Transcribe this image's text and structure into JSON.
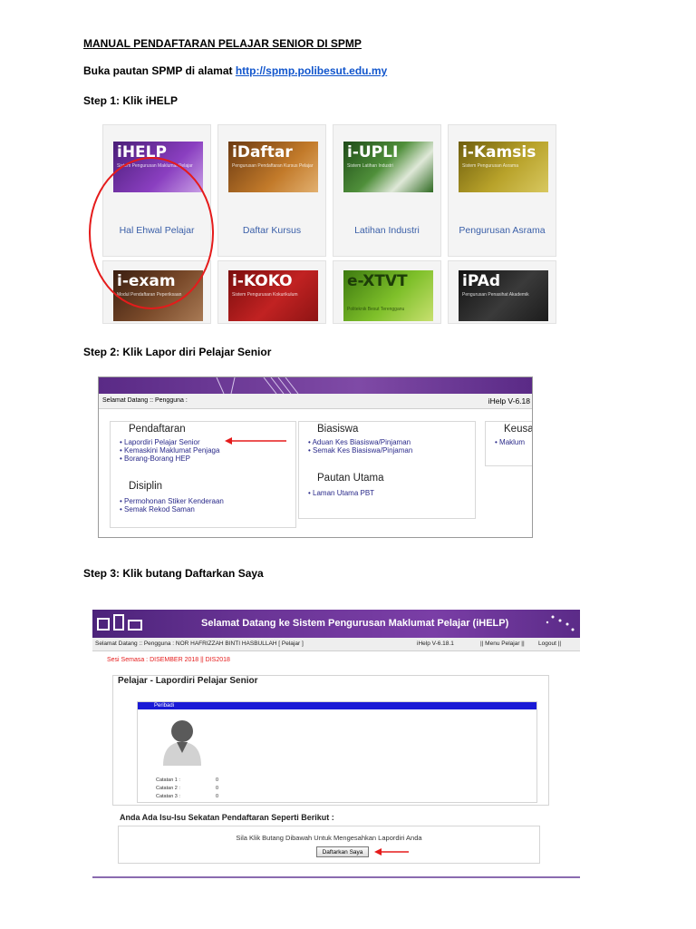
{
  "title": "MANUAL PENDAFTARAN PELAJAR SENIOR DI SPMP",
  "intro": {
    "text": "Buka pautan  SPMP di alamat ",
    "link": "http://spmp.polibesut.edu.my"
  },
  "step1": {
    "heading": "Step 1: Klik iHELP",
    "tiles": [
      {
        "banner": "iHELP",
        "sub": "Sistem Pengurusan Maklumat Pelajar",
        "label": "Hal Ehwal Pelajar",
        "color": "#6b2b9e"
      },
      {
        "banner": "iDaftar",
        "sub": "Pengurusan Pendaftaran Kursus Pelajar",
        "label": "Daftar Kursus",
        "color": "#b5651d"
      },
      {
        "banner": "i-UPLI",
        "sub": "Sistem Latihan Industri",
        "label": "Latihan Industri",
        "color": "#3d7a2d"
      },
      {
        "banner": "i-Kamsis",
        "sub": "Sistem Pengurusan Asrama",
        "label": "Pengurusan Asrama",
        "color": "#9a8a1a"
      },
      {
        "banner": "i-exam",
        "sub": "Modul Pendaftaran Peperiksaan",
        "label": "",
        "color": "#6b3b22"
      },
      {
        "banner": "i-KOKO",
        "sub": "Sistem Pengurusan Kokurikulum",
        "label": "",
        "color": "#a81b1b"
      },
      {
        "banner": "e-XTVT",
        "sub": "Politeknik Besut Terengganu",
        "label": "",
        "color": "#5e9a1e"
      },
      {
        "banner": "iPAd",
        "sub": "Pengurusan Penasihat Akademik",
        "label": "",
        "color": "#2a2a2a"
      }
    ]
  },
  "step2": {
    "heading": "Step 2: Klik Lapor diri Pelajar Senior",
    "welcome": "Selamat Datang :: Pengguna :",
    "version": "iHelp V-6.18",
    "pendaftaran": {
      "title": "Pendaftaran",
      "items": [
        "Lapordiri Pelajar Senior",
        "Kemaskini Maklumat Penjaga",
        "Borang-Borang HEP"
      ]
    },
    "disiplin": {
      "title": "Disiplin",
      "items": [
        "Permohonan Stiker Kenderaan",
        "Semak Rekod Saman"
      ]
    },
    "biasiswa": {
      "title": "Biasiswa",
      "items": [
        "Aduan Kes Biasiswa/Pinjaman",
        "Semak Kes Biasiswa/Pinjaman"
      ]
    },
    "pautan": {
      "title": "Pautan Utama",
      "items": [
        "Laman Utama PBT"
      ]
    },
    "keusahawanan": {
      "title": "Keusa",
      "items": [
        "Maklum"
      ]
    }
  },
  "step3": {
    "heading": "Step 3: Klik butang Daftarkan Saya",
    "header_title": "Selamat Datang ke Sistem Pengurusan Maklumat Pelajar (iHELP)",
    "welcome": "Selamat Datang :: Pengguna : NOR HAFRIZZAH BINTI HASBULLAH [ Pelajar ]",
    "version": "iHelp V-6.18.1",
    "menu": "|| Menu Pelajar ||",
    "logout": "Logout ||",
    "session": "Sesi Semasa : DISEMBER 2018 || DIS2018",
    "page_title": "Pelajar - Lapordiri Pelajar Senior",
    "section": "Peribadi",
    "catatan": [
      {
        "label": "Catatan 1 :",
        "value": "0"
      },
      {
        "label": "Catatan 2 :",
        "value": "0"
      },
      {
        "label": "Catatan 3 :",
        "value": "0"
      }
    ],
    "issue_title": "Anda Ada Isu-Isu Sekatan Pendaftaran Seperti Berikut :",
    "instruction": "Sila Klik Butang Dibawah Untuk Mengesahkan Lapordiri Anda",
    "button": "Daftarkan Saya"
  },
  "colors": {
    "accent_red": "#e51b1b",
    "link_blue": "#1155cc",
    "ihelp_purple": "#5b2b88",
    "section_blue": "#1a1ad6"
  }
}
